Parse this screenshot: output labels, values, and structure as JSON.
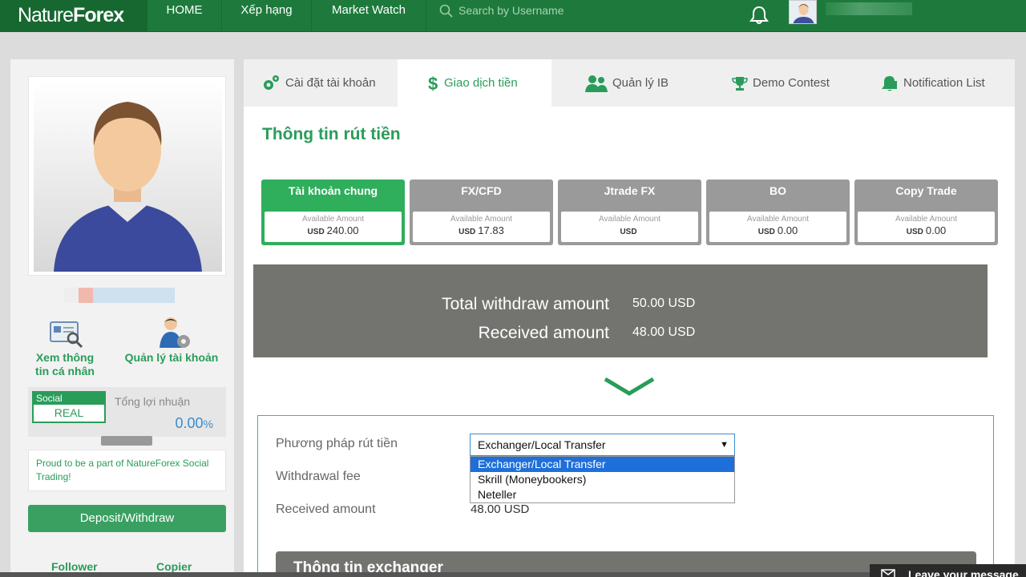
{
  "brand": {
    "logo_part1": "Nature",
    "logo_part2": "Forex"
  },
  "nav": {
    "items": [
      "HOME",
      "Xếp hạng",
      "Market Watch"
    ],
    "search_placeholder": "Search by Username"
  },
  "sidebar": {
    "view_profile": "Xem thông tin cá nhân",
    "manage_account": "Quản lý tài khoản",
    "social_label": "Social",
    "real_label": "REAL",
    "profit_label": "Tổng lợi nhuận",
    "profit_value": "0.00",
    "profit_unit": "%",
    "social_message": "Proud to be a part of NatureForex Social Trading!",
    "deposit_button": "Deposit/Withdraw",
    "follower": "Follower",
    "copier": "Copier"
  },
  "tabs": [
    {
      "label": "Cài đặt tài khoản",
      "icon": "gears-icon"
    },
    {
      "label": "Giao dịch tiền",
      "icon": "dollar-icon"
    },
    {
      "label": "Quản lý IB",
      "icon": "users-icon"
    },
    {
      "label": "Demo Contest",
      "icon": "trophy-icon"
    },
    {
      "label": "Notification List",
      "icon": "bell-icon"
    }
  ],
  "page_title": "Thông tin rút tiền",
  "accounts": [
    {
      "name": "Tài khoản chung",
      "caption": "Available Amount",
      "currency": "USD",
      "amount": "240.00"
    },
    {
      "name": "FX/CFD",
      "caption": "Available Amount",
      "currency": "USD",
      "amount": "17.83"
    },
    {
      "name": "Jtrade FX",
      "caption": "Available Amount",
      "currency": "USD",
      "amount": ""
    },
    {
      "name": "BO",
      "caption": "Available Amount",
      "currency": "USD",
      "amount": "0.00"
    },
    {
      "name": "Copy Trade",
      "caption": "Available Amount",
      "currency": "USD",
      "amount": "0.00"
    }
  ],
  "summary": {
    "total_label": "Total withdraw amount",
    "total_value": "50.00 USD",
    "received_label": "Received amount",
    "received_value": "48.00 USD"
  },
  "form": {
    "method_label": "Phương pháp rút tiền",
    "method_selected": "Exchanger/Local Transfer",
    "method_options": [
      "Exchanger/Local Transfer",
      "Skrill (Moneybookers)",
      "Neteller"
    ],
    "fee_label": "Withdrawal fee",
    "received_label": "Received amount",
    "received_value": "48.00 USD"
  },
  "exchanger_header": "Thông tin exchanger",
  "chat": {
    "label": "Leave your message"
  },
  "colors": {
    "brand_green": "#1e7a3c",
    "accent_green": "#2fae5c",
    "panel_gray": "#737370"
  }
}
